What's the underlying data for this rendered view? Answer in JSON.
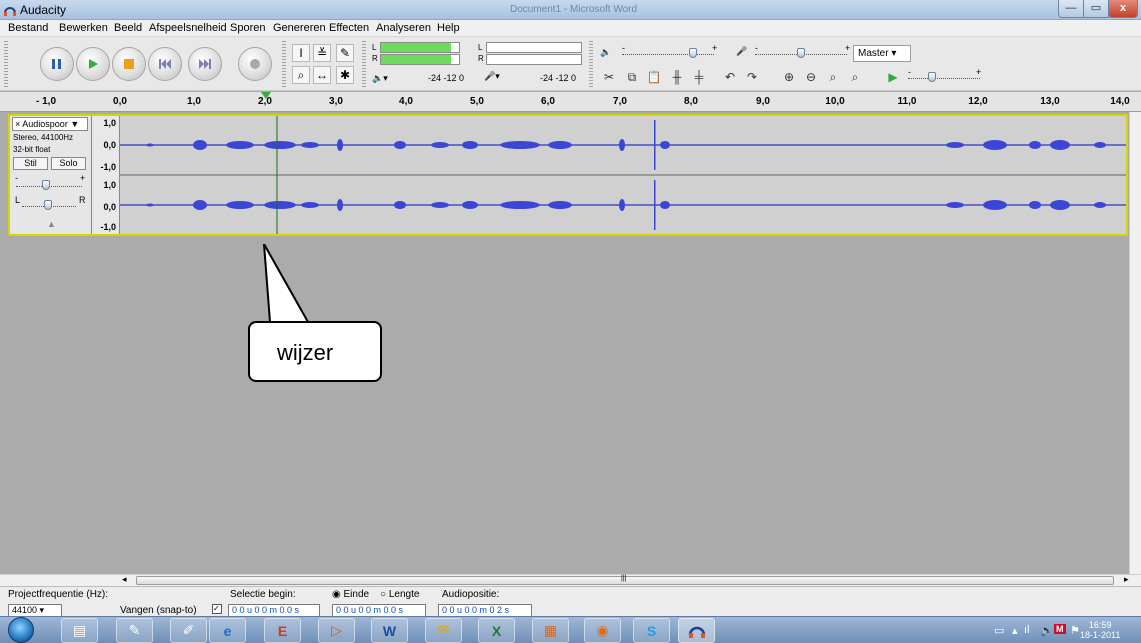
{
  "window": {
    "title": "Audacity",
    "background_title": "Document1 - Microsoft Word"
  },
  "window_buttons": {
    "min": "—",
    "max": "▭",
    "close": "x"
  },
  "menu": [
    "Bestand",
    "Bewerken",
    "Beeld",
    "Afspeelsnelheid",
    "Sporen",
    "Genereren",
    "Effecten",
    "Analyseren",
    "Help"
  ],
  "toolbar": {
    "meter_left": "L",
    "meter_right": "R",
    "meter_scale_play": "-24  -12  0",
    "meter_scale_rec": "-24  -12  0",
    "slider_minus": "-",
    "slider_plus": "+",
    "mixer_source": "Master"
  },
  "ruler": {
    "labels": [
      "- 1,0",
      "0,0",
      "1,0",
      "2,0",
      "3,0",
      "4,0",
      "5,0",
      "6,0",
      "7,0",
      "8,0",
      "9,0",
      "10,0",
      "11,0",
      "12,0",
      "13,0",
      "14,0"
    ]
  },
  "track": {
    "name": "Audiospoor",
    "info1": "Stereo, 44100Hz",
    "info2": "32-bit float",
    "mute": "Stil",
    "solo": "Solo",
    "gain_minus": "-",
    "gain_plus": "+",
    "pan_left": "L",
    "pan_right": "R",
    "scale_top": "1,0",
    "scale_mid": "0,0",
    "scale_bottom": "-1,0",
    "close_icon": "×",
    "menu_arrow": "▼",
    "collapse_arrow": "▲"
  },
  "callout": {
    "text": "wijzer"
  },
  "hscroll": {
    "left_arrow": "◂",
    "right_arrow": "▸",
    "grip": "|||"
  },
  "selection_bar": {
    "project_rate_label": "Projectfrequentie (Hz):",
    "project_rate_value": "44100",
    "snap_label": "Vangen (snap-to)",
    "selection_begin_label": "Selectie begin:",
    "end_label": "Einde",
    "length_label": "Lengte",
    "audio_position_label": "Audiopositie:",
    "time1": "0 0 u 0 0 m 0 0 s",
    "time2": "0 0 u 0 0 m 0 0 s",
    "time3": "0 0 u 0 0 m 0 2 s"
  },
  "taskbar": {
    "clock_time": "16:59",
    "clock_date": "18-1-2011"
  }
}
